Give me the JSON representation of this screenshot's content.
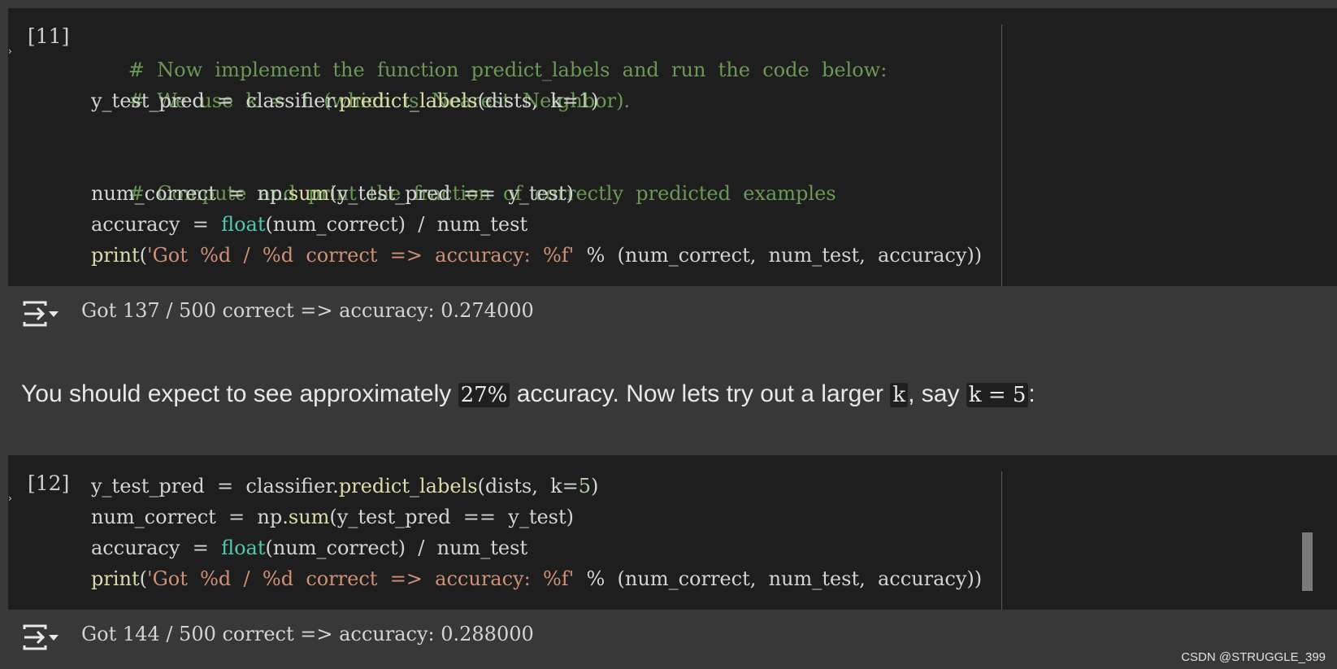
{
  "cell11": {
    "exec_count": "[11]",
    "lines": [
      "#  Now  implement  the  function  predict_labels  and  run  the  code  below:",
      "#  We  use  k  =  1  (which  is  Nearest  Neighbor).",
      "y_test_pred  =  classifier.predict_labels(dists,  k=1)",
      "",
      "#  Compute  and  print  the  fraction  of  correctly  predicted  examples",
      "num_correct  =  np.sum(y_test_pred  ==  y_test)",
      "accuracy  =  float(num_correct)  /  num_test",
      "print('Got  %d  /  %d  correct  =>  accuracy:  %f'  %  (num_correct,  num_test,  accuracy))"
    ],
    "output": "Got 137 / 500 correct => accuracy: 0.274000"
  },
  "markdown": {
    "text_1": "You should expect to see approximately ",
    "code_1": "27%",
    "text_2": " accuracy. Now lets try out a larger ",
    "code_2": "k",
    "text_3": ", say ",
    "code_3": "k = 5",
    "text_4": ":"
  },
  "cell12": {
    "exec_count": "[12]",
    "lines": [
      "y_test_pred  =  classifier.predict_labels(dists,  k=5)",
      "num_correct  =  np.sum(y_test_pred  ==  y_test)",
      "accuracy  =  float(num_correct)  /  num_test",
      "print('Got  %d  /  %d  correct  =>  accuracy:  %f'  %  (num_correct,  num_test,  accuracy))"
    ],
    "output": "Got 144 / 500 correct => accuracy: 0.288000"
  },
  "watermark": "CSDN @STRUGGLE_399",
  "icons": {
    "output_toggle": "output-collapse-icon"
  },
  "colors": {
    "background": "#383838",
    "cell_background": "#1e1e1e",
    "comment": "#6a9955",
    "function": "#dcdcaa",
    "builtin": "#4ec9b0",
    "string": "#ce9178",
    "number": "#b5cea8"
  }
}
